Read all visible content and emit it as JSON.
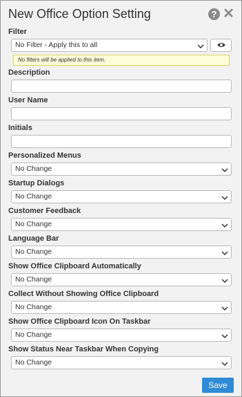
{
  "title": "New Office Option Setting",
  "icons": {
    "help": "help-icon",
    "close": "close-icon",
    "eye": "eye-icon",
    "chevron": "chevron-down-icon"
  },
  "filter": {
    "label": "Filter",
    "value": "No Filter - Apply this to all",
    "hint": "No filters will be applied to this item."
  },
  "description": {
    "label": "Description",
    "value": ""
  },
  "user_name": {
    "label": "User Name",
    "value": ""
  },
  "initials": {
    "label": "Initials",
    "value": ""
  },
  "selects": [
    {
      "label": "Personalized Menus",
      "value": "No Change"
    },
    {
      "label": "Startup Dialogs",
      "value": "No Change"
    },
    {
      "label": "Customer Feedback",
      "value": "No Change"
    },
    {
      "label": "Language Bar",
      "value": "No Change"
    },
    {
      "label": "Show Office Clipboard Automatically",
      "value": "No Change"
    },
    {
      "label": "Collect Without Showing Office Clipboard",
      "value": "No Change"
    },
    {
      "label": "Show Office Clipboard Icon On Taskbar",
      "value": "No Change"
    },
    {
      "label": "Show Status Near Taskbar When Copying",
      "value": "No Change"
    }
  ],
  "save_label": "Save",
  "colors": {
    "accent": "#2f8bd6",
    "hint_bg": "#fdfdd8",
    "panel_bg": "#f2f2f2"
  }
}
